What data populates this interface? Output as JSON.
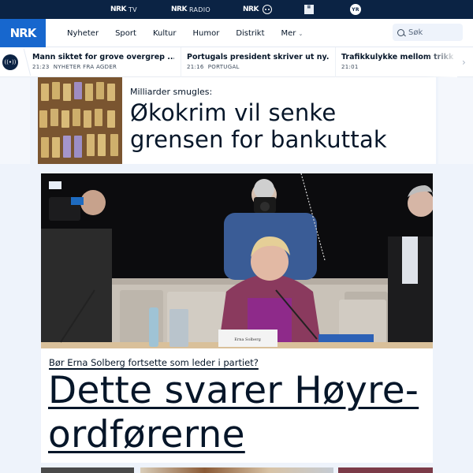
{
  "topbar": {
    "services": [
      {
        "logo": "NRK",
        "label": "TV"
      },
      {
        "logo": "NRK",
        "label": "RADIO"
      },
      {
        "logo": "NRK",
        "label": "Super"
      },
      {
        "logo": "P3",
        "label": ""
      },
      {
        "logo": "YR",
        "label": ""
      }
    ]
  },
  "header": {
    "brand": "NRK",
    "nav": [
      "Nyheter",
      "Sport",
      "Kultur",
      "Humor",
      "Distrikt",
      "Mer"
    ],
    "more_chevron": "⌄",
    "search_placeholder": "Søk"
  },
  "ticker": {
    "live_icon": "((•))",
    "next_icon": "›",
    "items": [
      {
        "title": "Mann siktet for grove overgrep ...",
        "time": "21:23",
        "category": "NYHETER FRA AGDER"
      },
      {
        "title": "Portugals president skriver ut ny...",
        "time": "21:16",
        "category": "PORTUGAL"
      },
      {
        "title": "Trafikkulykke mellom trikk og ...",
        "time": "21:01",
        "category": ""
      }
    ]
  },
  "articles": [
    {
      "kicker": "Milliarder smugles:",
      "title_line1": "Økokrim vil senke",
      "title_line2": "grensen for bankuttak",
      "image": "cash-bundles-photo"
    },
    {
      "kicker": "Bør Erna Solberg fortsette som leder i partiet?",
      "title_line1": "Dette svarer Høyre-",
      "title_line2": "ordførerne",
      "image": "erna-solberg-press-photo",
      "nameplate": "Erna Solberg"
    }
  ],
  "colors": {
    "topbar": "#0b2344",
    "brand": "#1767ce",
    "text": "#061629",
    "page_bg": "#eef3fb"
  }
}
